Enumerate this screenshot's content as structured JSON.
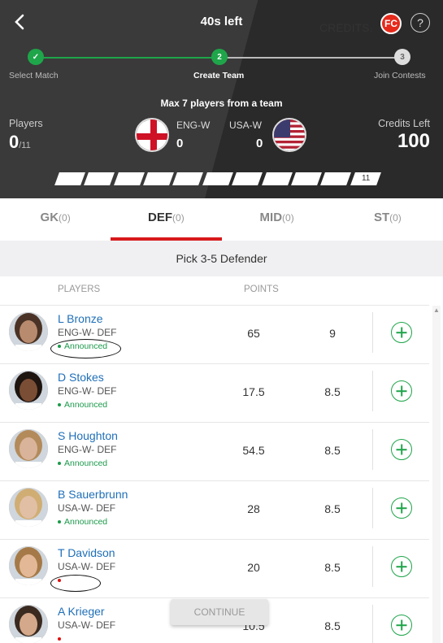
{
  "header": {
    "timer": "40s left",
    "logo_text": "FC",
    "help_label": "?",
    "steps": [
      {
        "label": "Select Match",
        "num": "✓",
        "state": "done"
      },
      {
        "label": "Create Team",
        "num": "2",
        "state": "active"
      },
      {
        "label": "Join Contests",
        "num": "3",
        "state": "pending"
      }
    ],
    "max_players": "Max 7 players from a team",
    "players_label": "Players",
    "players_count": "0",
    "players_max": "/11",
    "team1": {
      "code": "ENG-W",
      "count": "0"
    },
    "team2": {
      "code": "USA-W",
      "count": "0"
    },
    "credits_label": "Credits Left",
    "credits_value": "100",
    "slot_last_label": "11"
  },
  "tabs": [
    {
      "label": "GK",
      "count": "(0)",
      "active": false
    },
    {
      "label": "DEF",
      "count": "(0)",
      "active": true
    },
    {
      "label": "MID",
      "count": "(0)",
      "active": false
    },
    {
      "label": "ST",
      "count": "(0)",
      "active": false
    }
  ],
  "pick_text": "Pick 3-5 Defender",
  "columns": {
    "players": "PLAYERS",
    "points": "POINTS",
    "credits": "CREDITS"
  },
  "players": [
    {
      "name": "L Bronze",
      "team": "ENG-W- DEF",
      "status": "Announced",
      "points": "65",
      "credits": "9",
      "skin": "#b98b6e",
      "hair": "#4a3326"
    },
    {
      "name": "D Stokes",
      "team": "ENG-W- DEF",
      "status": "Announced",
      "points": "17.5",
      "credits": "8.5",
      "skin": "#7a4e35",
      "hair": "#1e1410"
    },
    {
      "name": "S Houghton",
      "team": "ENG-W- DEF",
      "status": "Announced",
      "points": "54.5",
      "credits": "8.5",
      "skin": "#d9b49a",
      "hair": "#b38a5a"
    },
    {
      "name": "B Sauerbrunn",
      "team": "USA-W- DEF",
      "status": "Announced",
      "points": "28",
      "credits": "8.5",
      "skin": "#e1bfa5",
      "hair": "#d0ad73"
    },
    {
      "name": "T Davidson",
      "team": "USA-W- DEF",
      "status": "",
      "points": "20",
      "credits": "8.5",
      "skin": "#e3b897",
      "hair": "#a57a48"
    },
    {
      "name": "A Krieger",
      "team": "USA-W- DEF",
      "status": "",
      "points": "10.5",
      "credits": "8.5",
      "skin": "#d4a88a",
      "hair": "#3a2a20"
    }
  ],
  "continue_label": "CONTINUE",
  "colors": {
    "accent_red": "#d8191b",
    "green": "#1fa54a",
    "link_blue": "#1f6fb8"
  }
}
